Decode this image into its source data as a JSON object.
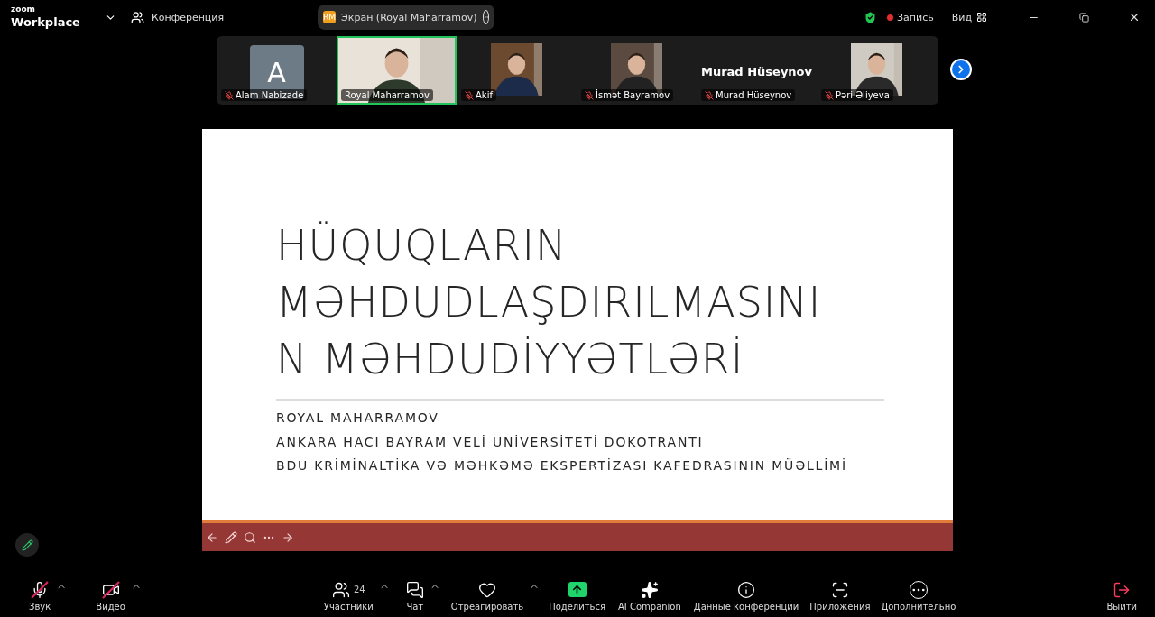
{
  "app": {
    "logo_top": "zoom",
    "logo_bottom": "Workplace",
    "meeting_label": "Конференция"
  },
  "share_pill": {
    "initials": "RM",
    "label": "Экран (Royal Maharramov)"
  },
  "status": {
    "secure": true,
    "recording": true,
    "recording_label": "Запись",
    "view_label": "Вид"
  },
  "participants": [
    {
      "kind": "avatar",
      "letter": "A",
      "name": "Alam Nabizade",
      "muted": true,
      "selected": false
    },
    {
      "kind": "video",
      "name": "Royal Maharramov",
      "muted": false,
      "selected": true
    },
    {
      "kind": "video",
      "name": "Akif",
      "muted": true,
      "selected": false
    },
    {
      "kind": "video",
      "name": "İsmət Bayramov",
      "muted": true,
      "selected": false
    },
    {
      "kind": "name_card",
      "card_name": "Murad Hüseynov",
      "name": "Murad Hüseynov",
      "muted": true,
      "selected": false
    },
    {
      "kind": "video",
      "name": "Pəri Əliyeva",
      "muted": true,
      "selected": false
    }
  ],
  "slide": {
    "title_lines": [
      "HÜQUQLARIN",
      "MƏHDUDLAŞDIRILMASINI",
      "N MƏHDUDİYYƏTLƏRİ"
    ],
    "subtitle_lines": [
      "ROYAL MAHARRAMOV",
      "ANKARA HACI BAYRAM VELİ UNİVERSİTETİ DOKOTRANTI",
      "BDU KRİMİNALTİKA VƏ MƏHKƏMƏ EKSPERTİZASI KAFEDRASININ MÜƏLLİMİ"
    ]
  },
  "toolbar": [
    {
      "kind": "audio",
      "label": "Звук",
      "muted": true
    },
    {
      "kind": "video",
      "label": "Видео",
      "muted": true
    },
    {
      "kind": "participants",
      "label": "Участники",
      "count": "24"
    },
    {
      "kind": "chat",
      "label": "Чат"
    },
    {
      "kind": "react",
      "label": "Отреагировать"
    },
    {
      "kind": "share",
      "label": "Поделиться"
    },
    {
      "kind": "ai",
      "label": "AI Companion"
    },
    {
      "kind": "info",
      "label": "Данные конференции"
    },
    {
      "kind": "apps",
      "label": "Приложения"
    },
    {
      "kind": "more",
      "label": "Дополнительно"
    },
    {
      "kind": "leave",
      "label": "Выйти"
    }
  ]
}
